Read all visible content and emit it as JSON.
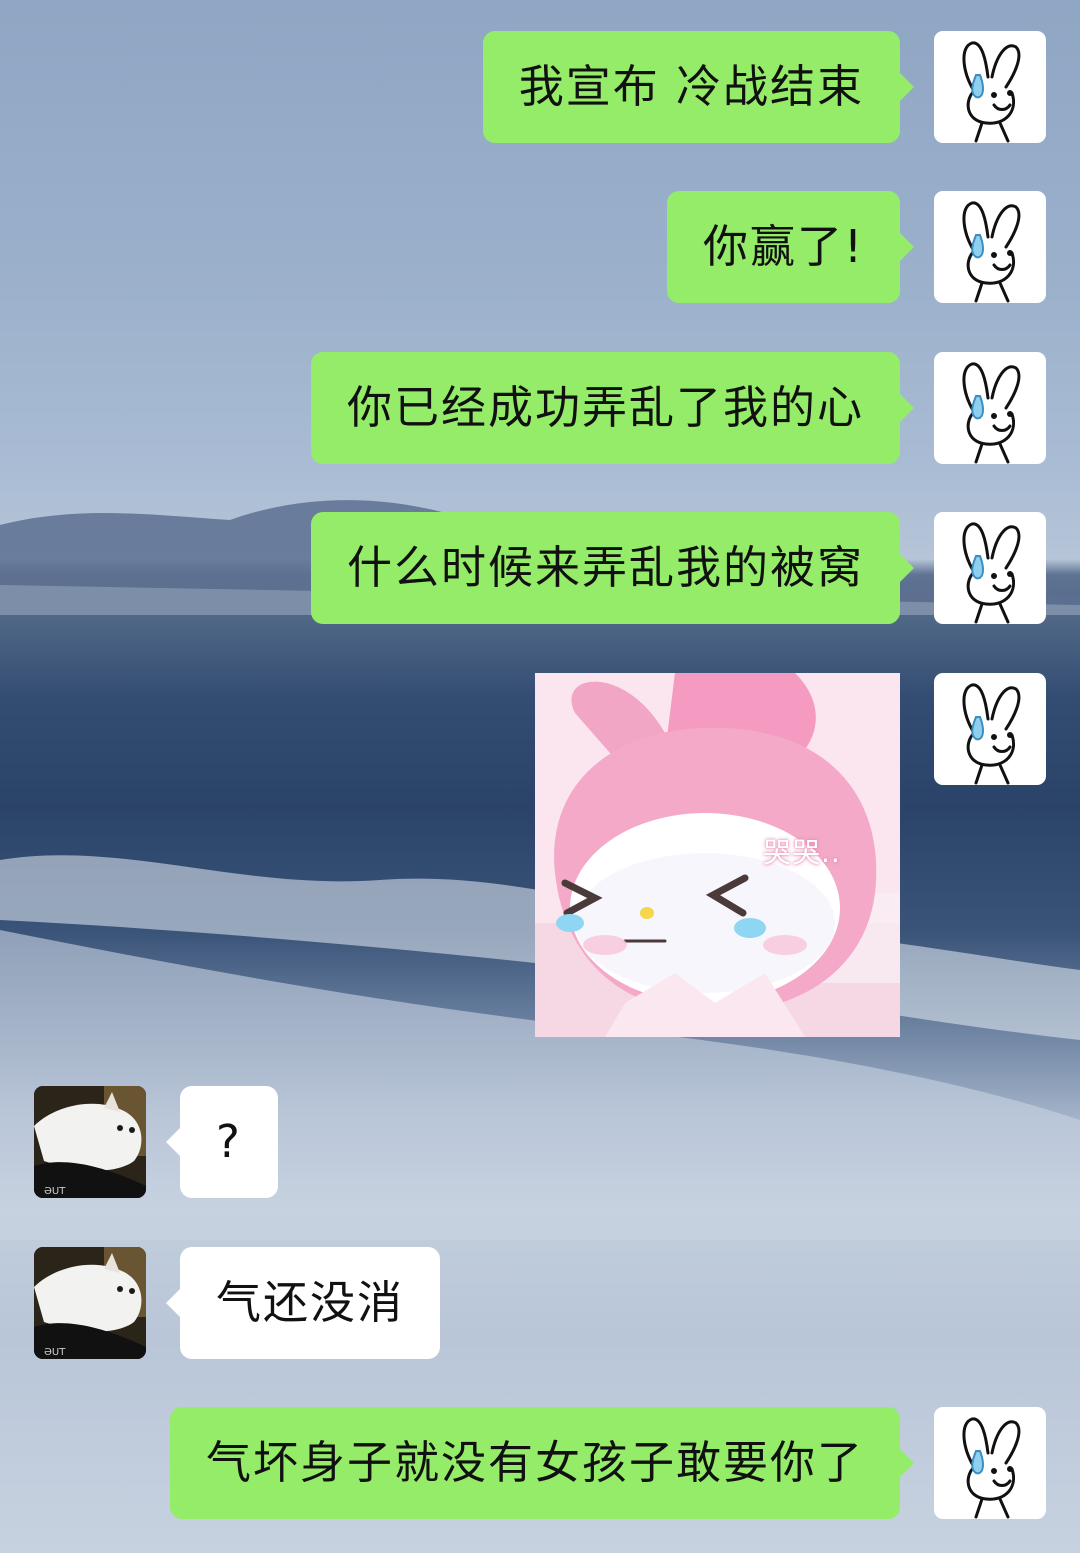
{
  "chat": {
    "messages": [
      {
        "sender": "me",
        "type": "text",
        "text": "我宣布 冷战结束"
      },
      {
        "sender": "me",
        "type": "text",
        "text": "你赢了!"
      },
      {
        "sender": "me",
        "type": "text",
        "text": "你已经成功弄乱了我的心"
      },
      {
        "sender": "me",
        "type": "text",
        "text": "什么时候来弄乱我的被窝"
      },
      {
        "sender": "me",
        "type": "sticker",
        "caption": "哭哭..",
        "icon": "crying-pink-bunny-sticker"
      },
      {
        "sender": "them",
        "type": "text",
        "text": "?"
      },
      {
        "sender": "them",
        "type": "text",
        "text": "气还没消"
      },
      {
        "sender": "me",
        "type": "text",
        "text": "气坏身子就没有女孩子敢要你了"
      }
    ]
  },
  "avatars": {
    "me": {
      "icon": "doodle-bunny-sweat-drop-icon"
    },
    "them": {
      "icon": "white-cat-photo-icon"
    }
  },
  "colors": {
    "my_bubble": "#95ec69",
    "their_bubble": "#ffffff",
    "text": "#111111"
  }
}
